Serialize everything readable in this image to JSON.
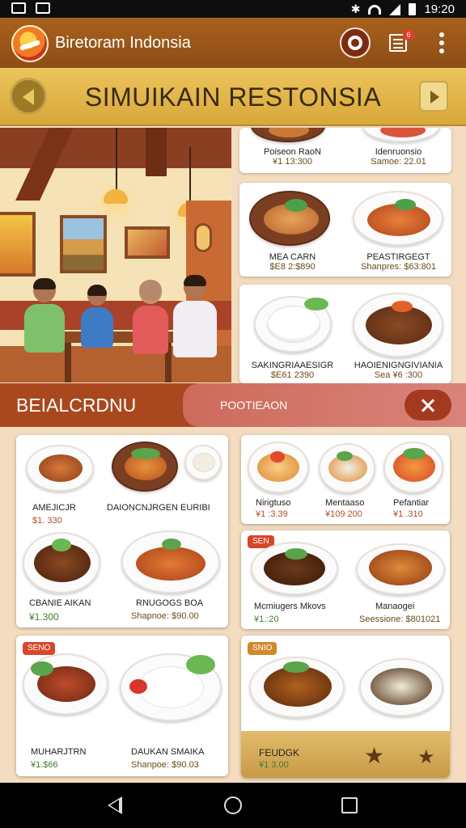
{
  "status_bar": {
    "time": "19:20"
  },
  "app_bar": {
    "title": "Biretoram Indonsia",
    "badge_count": "6"
  },
  "banner": {
    "title": "SIMUIKAIN RESTONSIA"
  },
  "scroll_list": [
    {
      "left_name": "Poiseon RaoN",
      "left_price": "¥1 13:300",
      "right_name": "Idenruonsio",
      "right_price": "Samoe: 22.01"
    },
    {
      "left_name": "MEA CARN",
      "left_price": "$E8 2:$890",
      "right_name": "PEASTIRGEGT",
      "right_price": "Shanpres: $63:801"
    },
    {
      "left_name": "SAKINGRIAAESIGR",
      "left_price": "$E61 2390",
      "right_name": "HAOIENIGNGIVIANIA",
      "right_price": "Sea ¥6 :300"
    }
  ],
  "section_bar": {
    "category": "BEIALCRDNU",
    "position": "POOTIEAON"
  },
  "cards": [
    {
      "items": [
        {
          "name": "AMEJICJR",
          "price": "$1. 330"
        },
        {
          "name": "DAIONCNJRGEN EURIBI",
          "price": ""
        },
        {
          "name": "CBANIE AIKAN",
          "price": "¥1.300"
        },
        {
          "name": "RNUGOGS BOA",
          "price": "Shapnoe: $90.00"
        }
      ]
    },
    {
      "items": [
        {
          "name": "Nirigtuso",
          "price": "¥1 :3.39"
        },
        {
          "name": "Mentaaso",
          "price": "¥109 200"
        },
        {
          "name": "Pefantiar",
          "price": "¥1 .310"
        }
      ]
    },
    {
      "tag": "SEN",
      "items": [
        {
          "name": "Mcmiugers Mkovs",
          "price": "¥1.:20"
        },
        {
          "name": "Manaogei",
          "price": "Seessione: $801021"
        }
      ]
    },
    {
      "tag": "SENO",
      "items": [
        {
          "name": "MUHARJTRN",
          "price": "¥1.$66"
        },
        {
          "name": "DAUKAN SMAIKA",
          "price": "Shanpoe: $90.03"
        }
      ]
    },
    {
      "tag": "SNIO",
      "items": [
        {
          "name": "FEUDGK",
          "price": "¥1 3.00"
        }
      ]
    }
  ]
}
